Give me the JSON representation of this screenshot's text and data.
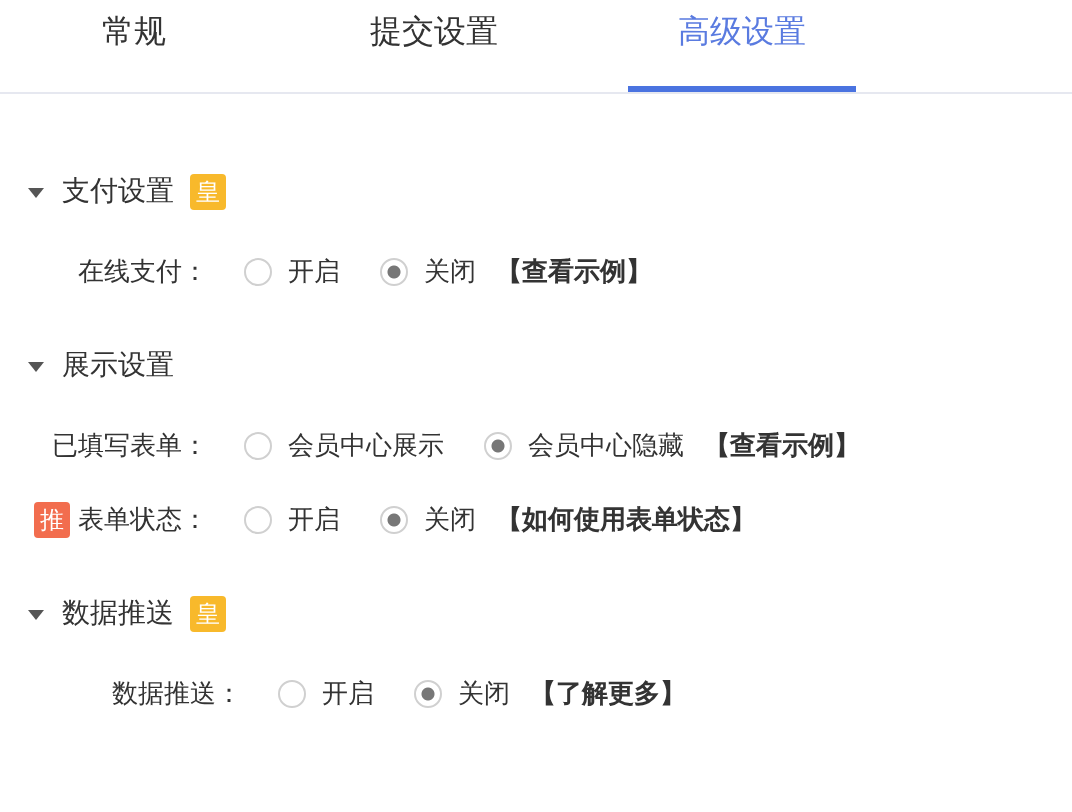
{
  "tabs": [
    {
      "label": "常规",
      "selected": false
    },
    {
      "label": "提交设置",
      "selected": false
    },
    {
      "label": "高级设置",
      "selected": true
    }
  ],
  "sections": [
    {
      "title": "支付设置",
      "expanded": true,
      "badge": "皇",
      "rows": [
        {
          "label": "在线支付：",
          "options": [
            {
              "label": "开启",
              "selected": false
            },
            {
              "label": "关闭",
              "selected": true
            }
          ],
          "link": "【查看示例】"
        }
      ]
    },
    {
      "title": "展示设置",
      "expanded": true,
      "rows": [
        {
          "label": "已填写表单：",
          "options": [
            {
              "label": "会员中心展示",
              "selected": false
            },
            {
              "label": "会员中心隐藏",
              "selected": true
            }
          ],
          "link": "【查看示例】"
        },
        {
          "label": "表单状态：",
          "badge": "推",
          "options": [
            {
              "label": "开启",
              "selected": false
            },
            {
              "label": "关闭",
              "selected": true
            }
          ],
          "link": "【如何使用表单状态】"
        }
      ]
    },
    {
      "title": "数据推送",
      "expanded": true,
      "badge": "皇",
      "rows": [
        {
          "label": "数据推送：",
          "options": [
            {
              "label": "开启",
              "selected": false
            },
            {
              "label": "关闭",
              "selected": true
            }
          ],
          "link": "【了解更多】"
        }
      ]
    }
  ]
}
